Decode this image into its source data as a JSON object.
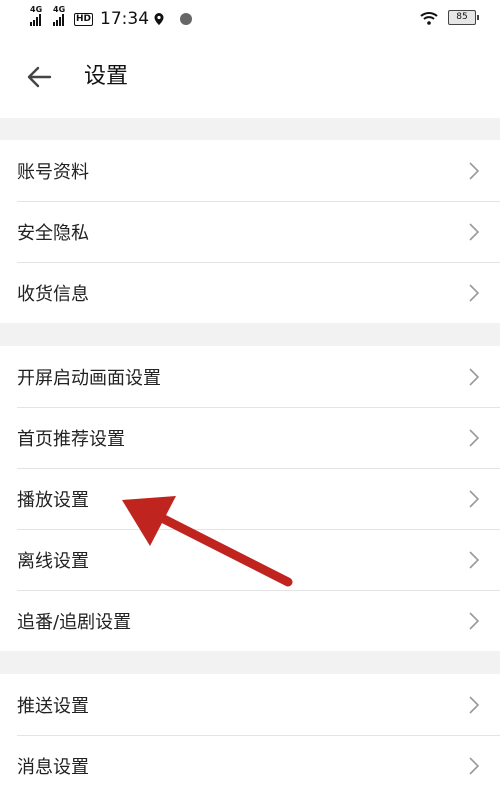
{
  "status_bar": {
    "signal1": "4G",
    "signal2": "4G",
    "hd": "HD",
    "time": "17:34",
    "battery": "85"
  },
  "header": {
    "title": "设置"
  },
  "groups": [
    {
      "items": [
        "账号资料",
        "安全隐私",
        "收货信息"
      ]
    },
    {
      "items": [
        "开屏启动画面设置",
        "首页推荐设置",
        "播放设置",
        "离线设置",
        "追番/追剧设置"
      ]
    },
    {
      "items": [
        "推送设置",
        "消息设置"
      ]
    }
  ],
  "annotation": {
    "color": "#c0241f",
    "points_to": "播放设置"
  },
  "colors": {
    "background": "#f2f2f2",
    "row": "#ffffff",
    "divider": "#e4e4e4",
    "chevron": "#9a9a9a"
  }
}
